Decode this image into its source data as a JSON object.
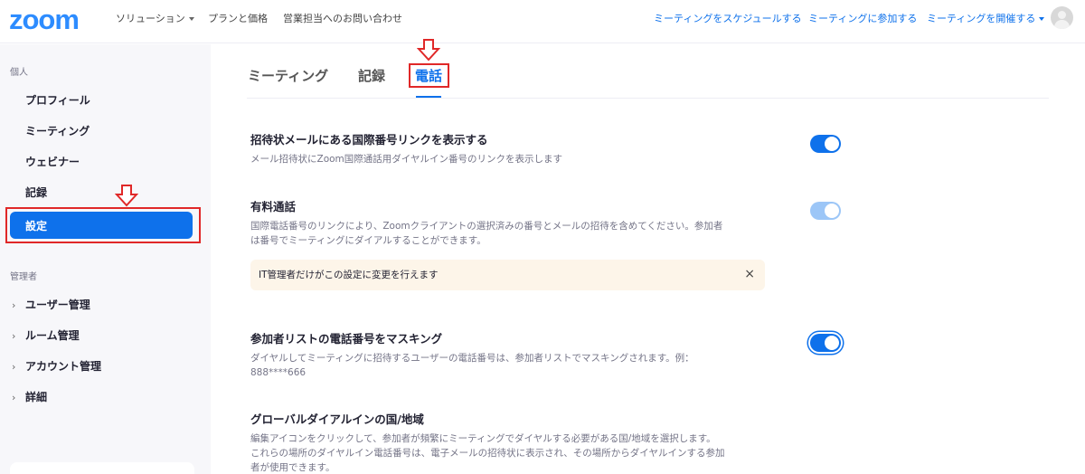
{
  "header": {
    "logo": "zoom",
    "nav_left": [
      "ソリューション",
      "プランと価格",
      "営業担当へのお問い合わせ"
    ],
    "nav_right": [
      "ミーティングをスケジュールする",
      "ミーティングに参加する",
      "ミーティングを開催する"
    ],
    "avatar_icon": "user-avatar-icon"
  },
  "sidebar": {
    "personal_label": "個人",
    "personal_items": [
      "プロフィール",
      "ミーティング",
      "ウェビナー",
      "記録",
      "設定"
    ],
    "active_item": "設定",
    "admin_label": "管理者",
    "admin_items": [
      "ユーザー管理",
      "ルーム管理",
      "アカウント管理",
      "詳細"
    ]
  },
  "tabs": {
    "items": [
      "ミーティング",
      "記録",
      "電話"
    ],
    "active": "電話"
  },
  "settings": [
    {
      "title": "招待状メールにある国際番号リンクを表示する",
      "description": "メール招待状にZoom国際通話用ダイヤルイン番号のリンクを表示します",
      "enabled": true,
      "locked": false
    },
    {
      "title": "有料通話",
      "description_line1": "国際電話番号のリンクにより、Zoomクライアントの選択済みの番号とメールの招待を含めてください。参加者",
      "description_line2": "は番号でミーティングにダイアルすることができます。",
      "enabled": true,
      "locked": true,
      "notice": "IT管理者だけがこの設定に変更を行えます",
      "notice_close": "×"
    },
    {
      "title": "参加者リストの電話番号をマスキング",
      "description_line1": "ダイヤルしてミーティングに招待するユーザーの電話番号は、参加者リストでマスキングされます。例：",
      "description_line2": "888****666",
      "enabled": true,
      "locked": false
    },
    {
      "title": "グローバルダイアルインの国/地域",
      "description_line1": "編集アイコンをクリックして、参加者が頻繁にミーティングでダイヤルする必要がある国/地域を選択します。",
      "description_line2": "これらの場所のダイヤルイン電話番号は、電子メールの招待状に表示され、その場所からダイヤルインする参加",
      "description_line3": "者が使用できます。"
    }
  ],
  "colors": {
    "brand": "#2d8cff",
    "accent": "#0e71eb",
    "highlight_box": "#e02828",
    "notice_bg": "#fdf5e9"
  }
}
